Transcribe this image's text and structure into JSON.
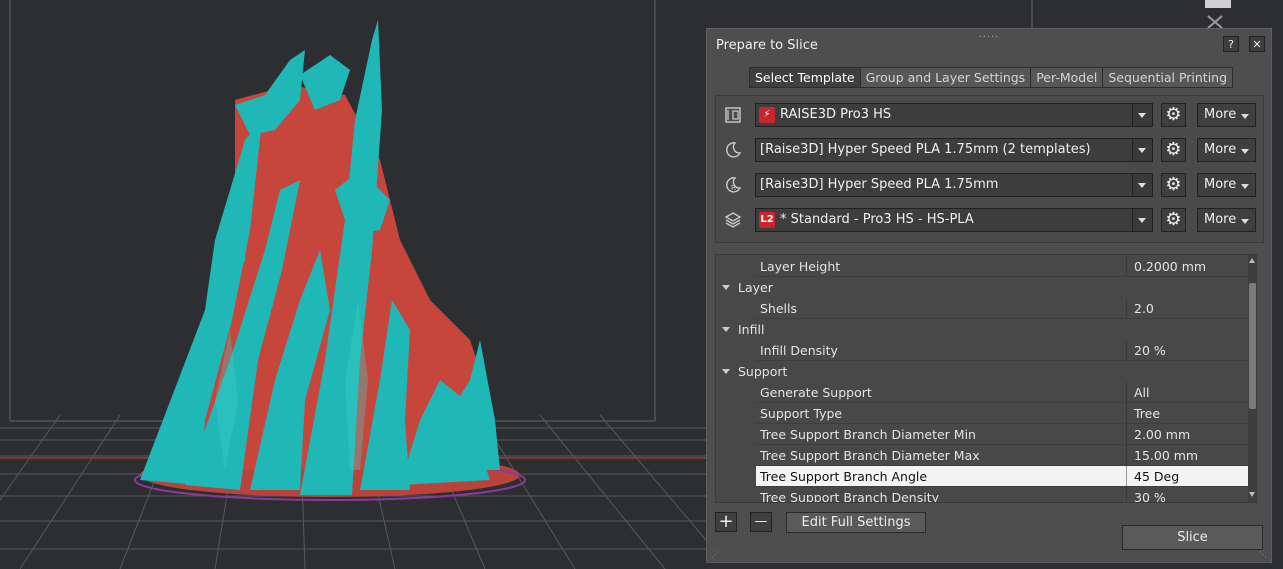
{
  "panel": {
    "title": "Prepare to Slice",
    "help_label": "?",
    "close_label": "✕",
    "grip": "....."
  },
  "tabs": [
    {
      "label": "Select Template",
      "active": true
    },
    {
      "label": "Group and Layer Settings",
      "active": false
    },
    {
      "label": "Per-Model",
      "active": false
    },
    {
      "label": "Sequential Printing",
      "active": false
    }
  ],
  "presets": {
    "printer": {
      "icon": "printer-icon",
      "badge_icon": "lightning-icon",
      "badge_text": "⚡",
      "value": "RAISE3D Pro3 HS"
    },
    "material_left": {
      "icon": "moon-extruder-left-icon",
      "value": "[Raise3D] Hyper Speed PLA 1.75mm (2 templates)"
    },
    "material_right": {
      "icon": "moon-extruder-right-icon",
      "value": "[Raise3D] Hyper Speed PLA 1.75mm"
    },
    "template": {
      "icon": "layers-icon",
      "badge_text": "L2",
      "value": "* Standard - Pro3 HS - HS-PLA"
    },
    "more_label": "More",
    "gear_glyph": "⚙"
  },
  "settings": [
    {
      "type": "item",
      "key": "Layer Height",
      "value": "0.2000 mm"
    },
    {
      "type": "section",
      "key": "Layer"
    },
    {
      "type": "item",
      "key": "Shells",
      "value": "2.0"
    },
    {
      "type": "section",
      "key": "Infill"
    },
    {
      "type": "item",
      "key": "Infill Density",
      "value": "20 %"
    },
    {
      "type": "section",
      "key": "Support"
    },
    {
      "type": "item",
      "key": "Generate Support",
      "value": "All"
    },
    {
      "type": "item",
      "key": "Support Type",
      "value": "Tree"
    },
    {
      "type": "item",
      "key": "Tree Support Branch Diameter Min",
      "value": "2.00 mm"
    },
    {
      "type": "item",
      "key": "Tree Support Branch Diameter Max",
      "value": "15.00 mm"
    },
    {
      "type": "item",
      "key": "Tree Support Branch Angle",
      "value": "45 Deg",
      "highlight": true
    },
    {
      "type": "item",
      "key": "Tree Support Branch Density",
      "value": "30 %"
    }
  ],
  "footer": {
    "add_glyph": "+",
    "remove_glyph": "—",
    "edit_full_label": "Edit Full Settings",
    "slice_label": "Slice"
  },
  "colors": {
    "model": "#1fb8b6",
    "support": "#c6463b",
    "background": "#2b2d31",
    "panel": "#4e4e4e",
    "accent_badge": "#c9252f"
  }
}
